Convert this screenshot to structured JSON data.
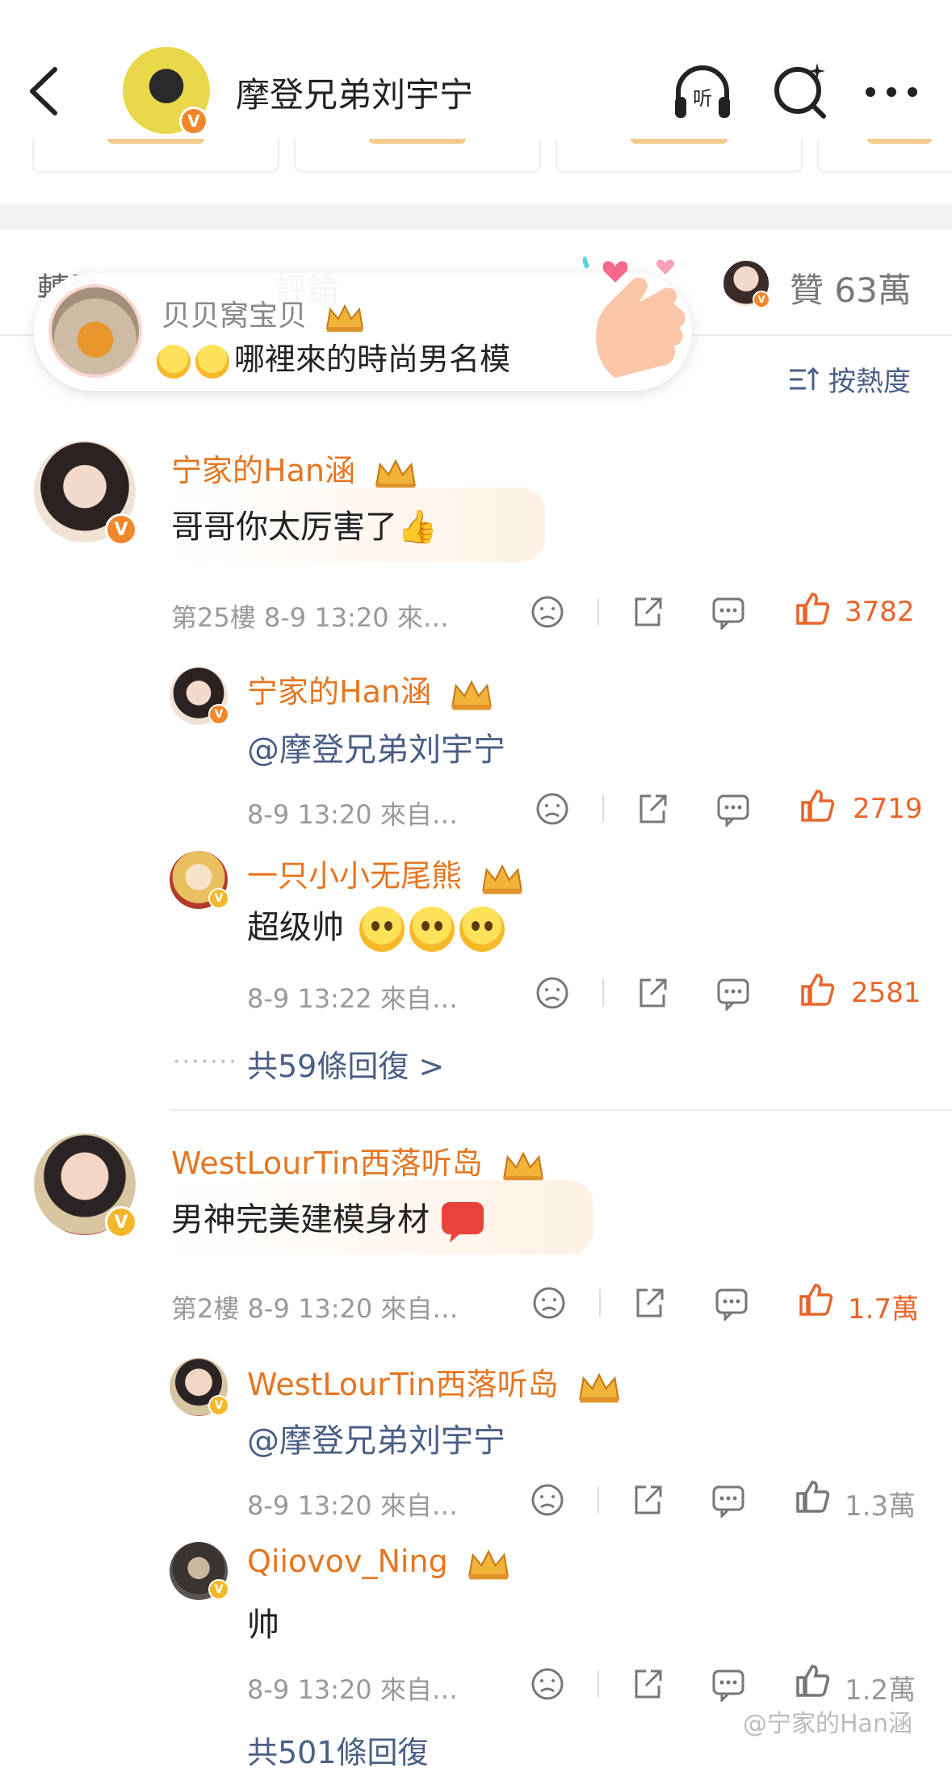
{
  "header": {
    "title": "摩登兄弟刘宇宁",
    "listen_icon_label": "听"
  },
  "tabs": {
    "repost": "轉發",
    "comments": "評論",
    "likes_label": "贊 63萬"
  },
  "sort_label": "按熱度",
  "popup": {
    "name": "贝贝窝宝贝",
    "message": "哪裡來的時尚男名模"
  },
  "comments": [
    {
      "username": "宁家的Han涵",
      "text": "哥哥你太厉害了👍",
      "meta": "第25樓 8-9 13:20 來…",
      "likes": "3782",
      "replies": [
        {
          "username": "宁家的Han涵",
          "text": "@摩登兄弟刘宇宁",
          "meta": "8-9 13:20 來自…",
          "likes": "2719"
        },
        {
          "username": "一只小小无尾熊",
          "text": "超级帅",
          "meta": "8-9 13:22 來自…",
          "likes": "2581"
        }
      ],
      "more_replies": "共59條回復 >"
    },
    {
      "username": "WestLourTin西落听岛",
      "text": "男神完美建模身材",
      "meta": "第2樓 8-9 13:20 來自…",
      "likes": "1.7萬",
      "replies": [
        {
          "username": "WestLourTin西落听岛",
          "text": "@摩登兄弟刘宇宁",
          "meta": "8-9 13:20 來自…",
          "likes": "1.3萬"
        },
        {
          "username": "Qiiovov_Ning",
          "text": "帅",
          "meta": "8-9 13:20 來自…",
          "likes": "1.2萬"
        }
      ],
      "more_replies": "共501條回復"
    }
  ],
  "watermark": "@宁家的Han涵",
  "colors": {
    "username": "#e57621",
    "liked": "#e8652a",
    "link": "#4b5e85",
    "meta": "#999999"
  }
}
